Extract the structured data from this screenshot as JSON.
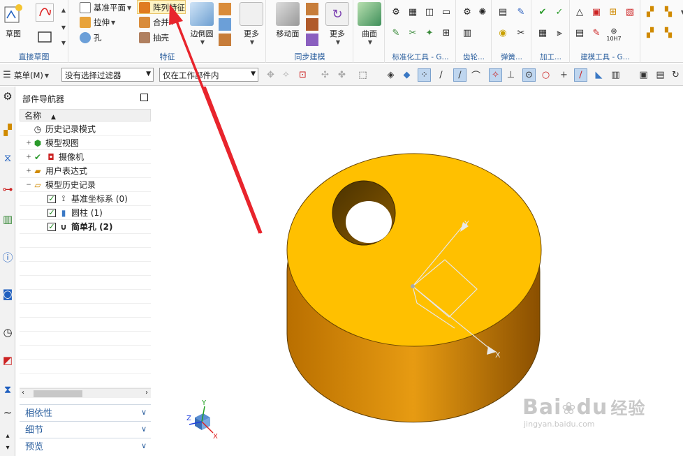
{
  "ribbon": {
    "sketch_label": "草图",
    "groups": {
      "direct_sketch": "直接草图",
      "feature": "特征",
      "sync_modeling": "同步建模",
      "std_tools": "标准化工具 - G...",
      "gear": "齿轮...",
      "spring": "弹簧...",
      "machining": "加工...",
      "modeling_tools": "建模工具 - G..."
    },
    "datum_plane": "基准平面",
    "extrude": "拉伸",
    "hole": "孔",
    "pattern_feature": "阵列特征",
    "unite": "合并",
    "shell": "抽壳",
    "edge_blend": "边倒圆",
    "more1": "更多",
    "move_face": "移动面",
    "more2": "更多",
    "surface": "曲面",
    "tolerance": "10H7"
  },
  "toolbar": {
    "menu": "菜单(M)",
    "filter": "没有选择过滤器",
    "scope": "仅在工作部件内"
  },
  "navigator": {
    "title": "部件导航器",
    "column_name": "名称",
    "items": [
      {
        "label": "历史记录模式"
      },
      {
        "label": "模型视图"
      },
      {
        "label": "摄像机"
      },
      {
        "label": "用户表达式"
      },
      {
        "label": "模型历史记录"
      },
      {
        "label": "基准坐标系 (0)"
      },
      {
        "label": "圆柱 (1)"
      },
      {
        "label": "简单孔 (2)"
      }
    ],
    "panels": [
      "相依性",
      "细节",
      "预览"
    ]
  },
  "viewport": {
    "axis_x": "X",
    "axis_y": "Y",
    "axis_z": "Z",
    "csys_y": "Y",
    "csys_x": "X",
    "watermark_main": "Bai",
    "watermark_du": "du",
    "watermark_cn": "经验",
    "watermark_url": "jingyan.baidu.com"
  },
  "colors": {
    "part_top": "#ffc000",
    "part_side": "#d68900",
    "arrow": "#e8242c",
    "accent": "#2b5f9e"
  }
}
